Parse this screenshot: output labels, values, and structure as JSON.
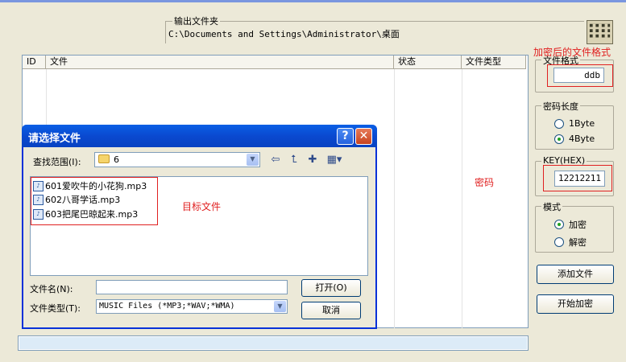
{
  "output_group": {
    "legend": "输出文件夹",
    "path": "C:\\Documents and Settings\\Administrator\\桌面"
  },
  "list": {
    "columns": [
      "ID",
      "文件",
      "状态",
      "文件类型"
    ]
  },
  "format_group": {
    "legend": "文件格式",
    "value": "ddb"
  },
  "keylen_group": {
    "legend": "密码长度",
    "options": [
      {
        "label": "1Byte",
        "checked": false
      },
      {
        "label": "4Byte",
        "checked": true
      }
    ]
  },
  "key_group": {
    "legend": "KEY(HEX)",
    "value": "12212211"
  },
  "mode_group": {
    "legend": "模式",
    "options": [
      {
        "label": "加密",
        "checked": true
      },
      {
        "label": "解密",
        "checked": false
      }
    ]
  },
  "buttons": {
    "add_file": "添加文件",
    "start_encrypt": "开始加密"
  },
  "annotations": {
    "format": "加密后的文件格式",
    "password": "密码",
    "target_files": "目标文件"
  },
  "dialog": {
    "title": "请选择文件",
    "look_in_label": "查找范围(I):",
    "look_in_value": "6",
    "files": [
      "601爱吹牛的小花狗.mp3",
      "602八哥学话.mp3",
      "603把尾巴晾起来.mp3"
    ],
    "filename_label": "文件名(N):",
    "filename_value": "",
    "filetype_label": "文件类型(T):",
    "filetype_value": "MUSIC Files (*MP3;*WAV;*WMA)",
    "open_button": "打开(O)",
    "cancel_button": "取消",
    "help_glyph": "?",
    "close_glyph": "✕"
  },
  "colors": {
    "annotation": "#e02020",
    "titlebar": "#0a49d0",
    "window_bg": "#ECE9D8"
  }
}
